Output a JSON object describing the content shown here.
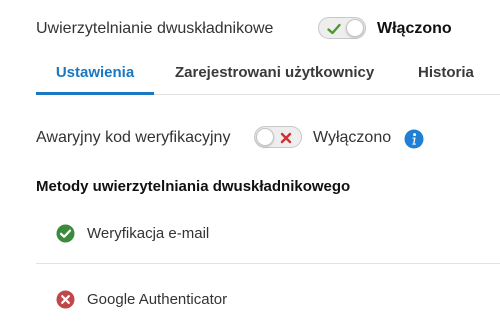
{
  "two_factor": {
    "label": "Uwierzytelnianie dwuskładnikowe",
    "toggle_state": "on",
    "status": "Włączono"
  },
  "tabs": [
    {
      "label": "Ustawienia",
      "active": true
    },
    {
      "label": "Zarejestrowani użytkownicy",
      "active": false
    },
    {
      "label": "Historia",
      "active": false
    }
  ],
  "backup_code": {
    "label": "Awaryjny kod weryfikacyjny",
    "toggle_state": "off",
    "status": "Wyłączono",
    "info_icon": "info-icon"
  },
  "methods": {
    "title": "Metody uwierzytelniania dwuskładnikowego",
    "items": [
      {
        "label": "Weryfikacja e-mail",
        "state": "enabled",
        "icon": "check-circle-icon"
      },
      {
        "label": "Google Authenticator",
        "state": "disabled",
        "icon": "x-circle-icon"
      }
    ]
  },
  "colors": {
    "accent": "#1a78c2",
    "success": "#3c8a3e",
    "danger": "#c0474a",
    "info": "#1f7fd4"
  }
}
